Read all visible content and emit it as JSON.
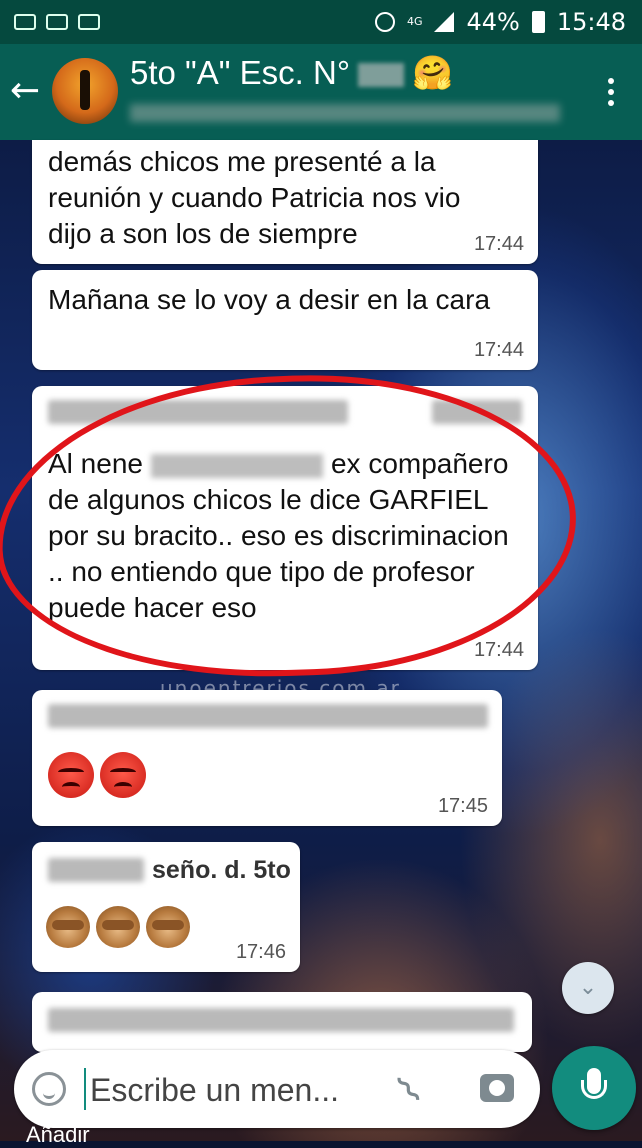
{
  "status_bar": {
    "network": "4G",
    "battery": "44%",
    "time": "15:48"
  },
  "header": {
    "title": "5to \"A\" Esc. N°",
    "title_emoji": "🤗"
  },
  "messages": [
    {
      "text": "demás chicos me presenté a la reunión y cuando Patricia nos vio dijo a son los de siempre",
      "time": "17:44"
    },
    {
      "text": "Mañana se lo voy a desir en la cara",
      "time": "17:44"
    },
    {
      "text_before": "Al nene",
      "text_after": "ex compañero de algunos chicos le dice GARFIEL por su bracito.. eso es discriminacion .. no entiendo que tipo de profesor puede hacer eso",
      "time": "17:44"
    },
    {
      "emojis": [
        "angry-face",
        "angry-face"
      ],
      "time": "17:45"
    },
    {
      "sender": "seño. d. 5to",
      "emojis": [
        "see-no-evil-monkey",
        "speak-no-evil-monkey",
        "hear-no-evil-monkey"
      ],
      "time": "17:46"
    }
  ],
  "watermark": "unoentrerios.com.ar",
  "input": {
    "placeholder": "Escribe un men..."
  },
  "bottom_label": "Añadir",
  "colors": {
    "header": "#075e54",
    "status_bar": "#05493e",
    "accent": "#128c7e",
    "annotation_circle": "#e0151a"
  }
}
